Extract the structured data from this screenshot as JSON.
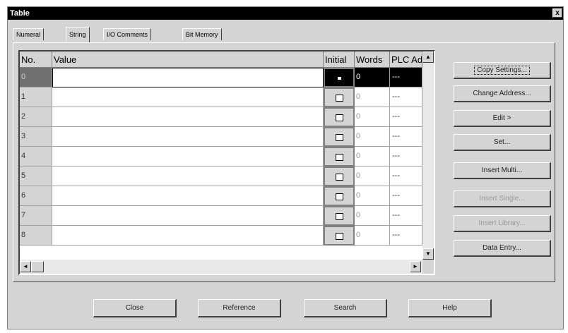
{
  "window": {
    "title": "Table",
    "close_symbol": "x"
  },
  "tabs": [
    {
      "label": "Numeral",
      "active": false
    },
    {
      "label": "String",
      "active": true
    },
    {
      "label": "I/O Comments",
      "active": false
    },
    {
      "label": "Bit Memory",
      "active": false
    }
  ],
  "grid": {
    "headers": {
      "no": "No.",
      "value": "Value",
      "initial": "Initial",
      "words": "Words",
      "plc": "PLC Ad"
    },
    "rows": [
      {
        "no": "0",
        "value": "",
        "initial": true,
        "words": "0",
        "plc": "---"
      },
      {
        "no": "1",
        "value": "",
        "initial": false,
        "words": "0",
        "plc": "---"
      },
      {
        "no": "2",
        "value": "",
        "initial": false,
        "words": "0",
        "plc": "---"
      },
      {
        "no": "3",
        "value": "",
        "initial": false,
        "words": "0",
        "plc": "---"
      },
      {
        "no": "4",
        "value": "",
        "initial": false,
        "words": "0",
        "plc": "---"
      },
      {
        "no": "5",
        "value": "",
        "initial": false,
        "words": "0",
        "plc": "---"
      },
      {
        "no": "6",
        "value": "",
        "initial": false,
        "words": "0",
        "plc": "---"
      },
      {
        "no": "7",
        "value": "",
        "initial": false,
        "words": "0",
        "plc": "---"
      },
      {
        "no": "8",
        "value": "",
        "initial": false,
        "words": "0",
        "plc": "---"
      }
    ],
    "selected_row": 0,
    "scroll": {
      "up": "▲",
      "down": "▼",
      "left": "◄",
      "right": "►"
    }
  },
  "side_buttons": [
    {
      "label": "Copy Settings...",
      "enabled": true,
      "focused": true
    },
    {
      "label": "Change Address...",
      "enabled": true,
      "focused": false
    },
    {
      "label": "Edit >",
      "enabled": true,
      "focused": false
    },
    {
      "label": "Set...",
      "enabled": true,
      "focused": false
    },
    {
      "label": "Insert Multi...",
      "enabled": true,
      "focused": false
    },
    {
      "label": "Insert Single...",
      "enabled": false,
      "focused": false
    },
    {
      "label": "Insert Library...",
      "enabled": false,
      "focused": false
    },
    {
      "label": "Data Entry...",
      "enabled": true,
      "focused": false
    }
  ],
  "bottom_buttons": [
    {
      "label": "Close"
    },
    {
      "label": "Reference"
    },
    {
      "label": "Search"
    },
    {
      "label": "Help"
    }
  ]
}
